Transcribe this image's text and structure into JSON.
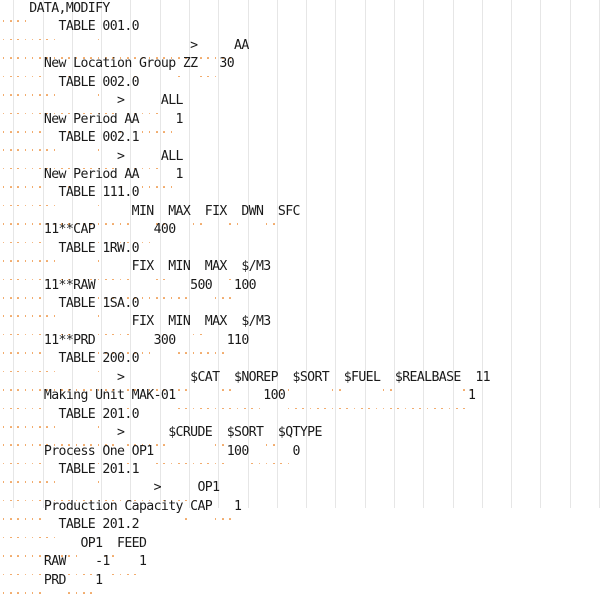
{
  "editor": {
    "title": "DATA,MODIFY table definition",
    "char_width": 7.32,
    "line_height": 18.45,
    "font_size": 13.2,
    "colors": {
      "background": "#ffffff",
      "text": "#1a1a1a",
      "whitespace_dot": "#f0a15a",
      "indent_guide": "#e6e6e6"
    },
    "guide_columns": [
      1,
      5,
      9,
      13,
      17,
      21,
      25,
      29,
      33,
      37,
      41,
      45,
      49,
      53,
      57,
      61,
      65,
      69,
      73,
      77,
      81
    ],
    "lines": [
      "    DATA,MODIFY",
      "        TABLE 001.0",
      "                          >     AA",
      "      New Location Group ZZ   30",
      "        TABLE 002.0",
      "                >     ALL",
      "      New Period AA     1",
      "        TABLE 002.1",
      "                >     ALL",
      "      New Period AA     1",
      "        TABLE 111.0",
      "                  MIN  MAX  FIX  DWN  SFC",
      "      11**CAP        400",
      "        TABLE 1RW.0",
      "                  FIX  MIN  MAX  $/M3",
      "      11**RAW             500   100",
      "        TABLE 1SA.0",
      "                  FIX  MIN  MAX  $/M3",
      "      11**PRD        300       110",
      "        TABLE 200.0",
      "                >         $CAT  $NOREP  $SORT  $FUEL  $REALBASE  11",
      "      Making Unit MAK-01            100                         1",
      "        TABLE 201.0",
      "                >      $CRUDE  $SORT  $QTYPE",
      "      Process One OP1          100      0",
      "        TABLE 201.1",
      "                     >     OP1",
      "      Production Capacity CAP   1",
      "        TABLE 201.2",
      "           OP1  FEED",
      "      RAW    -1    1",
      "      PRD    1"
    ]
  }
}
